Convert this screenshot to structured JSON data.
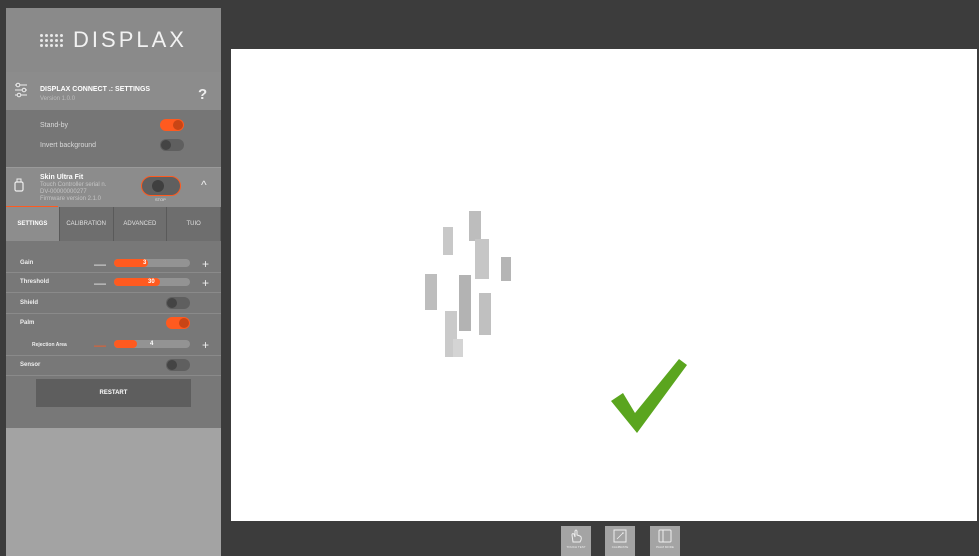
{
  "app": {
    "logo_text": "DISPLAX"
  },
  "connect": {
    "title": "DISPLAX CONNECT .: SETTINGS",
    "version": "Version 1.0.0",
    "help_glyph": "?",
    "standby_label": "Stand-by",
    "standby_on": true,
    "invert_label": "Invert background",
    "invert_on": false
  },
  "device": {
    "name": "Skin Ultra Fit",
    "line1": "Touch Controller serial n.",
    "line2": "DV-00000000277",
    "line3": "Firmware version 2.1.0",
    "stop_label": "STOP",
    "collapse_glyph": "^"
  },
  "tabs": [
    {
      "label": "SETTINGS",
      "active": true
    },
    {
      "label": "CALIBRATION",
      "active": false
    },
    {
      "label": "ADVANCED",
      "active": false
    },
    {
      "label": "TUIO",
      "active": false
    }
  ],
  "settings": {
    "gain": {
      "label": "Gain",
      "value": "3",
      "fraction": 0.45
    },
    "threshold": {
      "label": "Threshold",
      "value": "30",
      "fraction": 0.6
    },
    "shield": {
      "label": "Shield",
      "on": false
    },
    "palm": {
      "label": "Palm",
      "on": true
    },
    "rejection": {
      "label": "Rejection Area",
      "value": "4",
      "fraction": 0.3
    },
    "sensor": {
      "label": "Sensor",
      "on": false
    },
    "minus_glyph": "—",
    "plus_glyph": "+",
    "restart_label": "RESTART"
  },
  "toolbar": [
    {
      "icon": "touch-test-icon",
      "label": "TOUCH TEST"
    },
    {
      "icon": "calibrate-icon",
      "label": "CALIBRATE"
    },
    {
      "icon": "palm-mode-icon",
      "label": "PALM MODE"
    }
  ],
  "colors": {
    "accent": "#ff5a1f",
    "check": "#5aa51e"
  }
}
